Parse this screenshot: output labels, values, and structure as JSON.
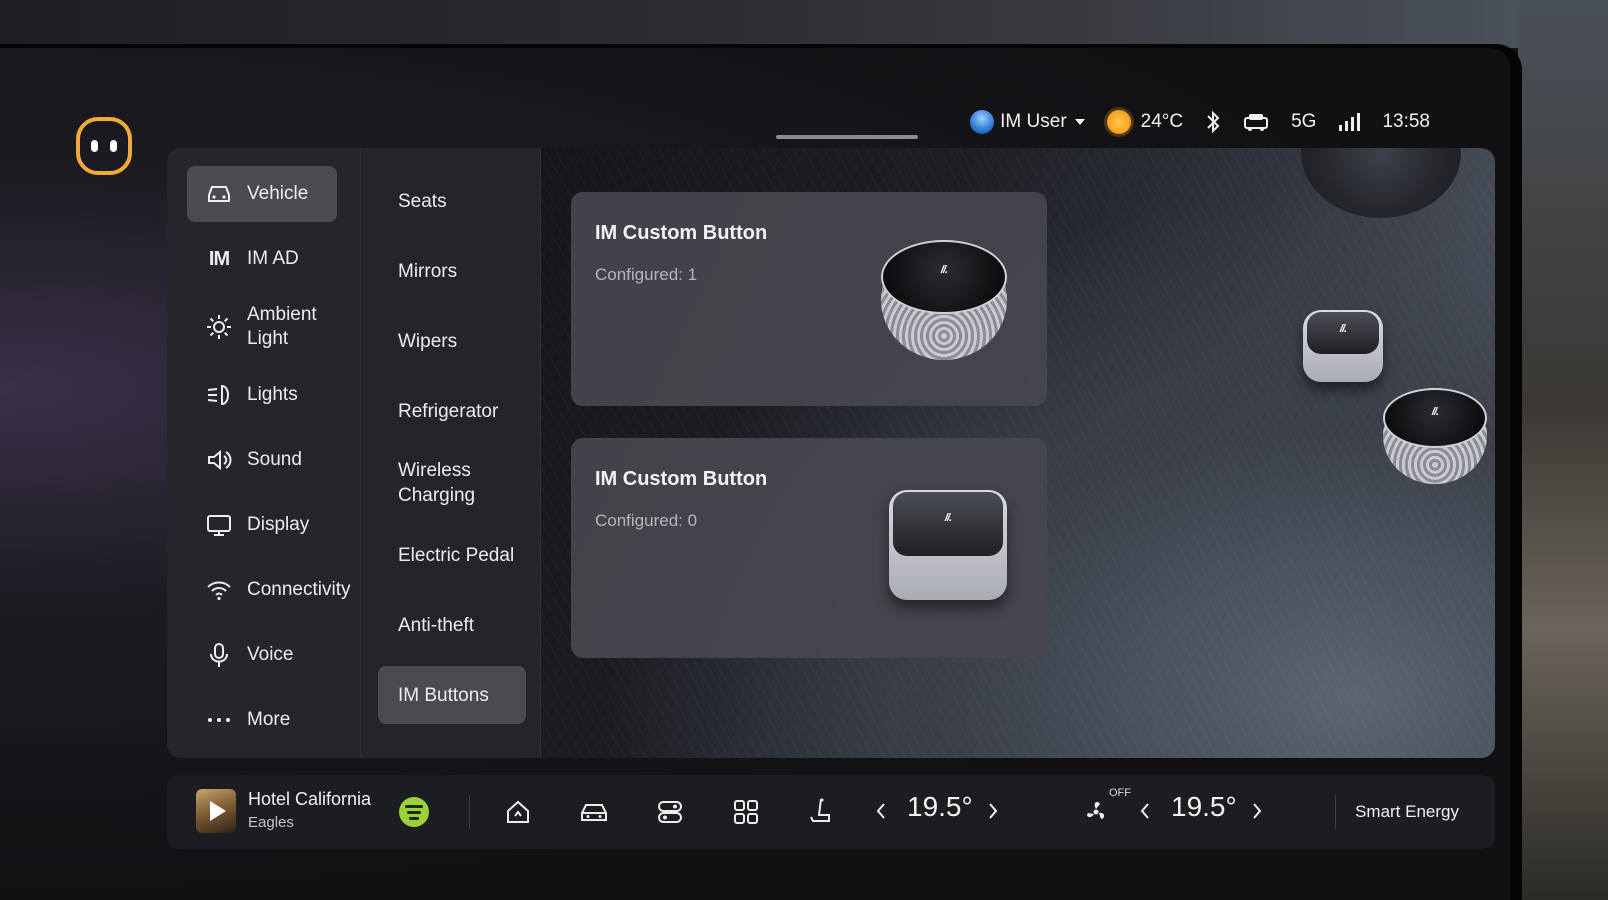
{
  "status_bar": {
    "user_name": "IM User",
    "temperature": "24°C",
    "network": "5G",
    "time": "13:58"
  },
  "nav": {
    "items": [
      {
        "label": "Vehicle",
        "icon": "car-icon",
        "active": true
      },
      {
        "label": "IM AD",
        "icon": "im-logo-icon",
        "active": false
      },
      {
        "label": "Ambient\nLight",
        "icon": "sun-icon",
        "active": false
      },
      {
        "label": "Lights",
        "icon": "headlight-icon",
        "active": false
      },
      {
        "label": "Sound",
        "icon": "speaker-icon",
        "active": false
      },
      {
        "label": "Display",
        "icon": "monitor-icon",
        "active": false
      },
      {
        "label": "Connectivity",
        "icon": "wifi-icon",
        "active": false
      },
      {
        "label": "Voice",
        "icon": "microphone-icon",
        "active": false
      },
      {
        "label": "More",
        "icon": "more-dots-icon",
        "active": false
      }
    ],
    "im_mark": "IM"
  },
  "subnav": {
    "items": [
      {
        "label": "Seats",
        "active": false
      },
      {
        "label": "Mirrors",
        "active": false
      },
      {
        "label": "Wipers",
        "active": false
      },
      {
        "label": "Refrigerator",
        "active": false
      },
      {
        "label": "Wireless\nCharging",
        "active": false
      },
      {
        "label": "Electric Pedal",
        "active": false
      },
      {
        "label": "Anti-theft",
        "active": false
      },
      {
        "label": "IM Buttons",
        "active": true
      }
    ]
  },
  "cards": [
    {
      "title": "IM Custom Button",
      "meta": "Configured: 1",
      "image": "round-knob-button"
    },
    {
      "title": "IM Custom Button",
      "meta": "Configured: 0",
      "image": "square-cube-button"
    }
  ],
  "dock": {
    "track_name": "Hotel California",
    "artist": "Eagles",
    "left_temp": "19.5°",
    "right_temp": "19.5°",
    "fan_state": "OFF",
    "smart_label": "Smart Energy"
  },
  "colors": {
    "accent": "#f2a93b",
    "active_item": "#4a4b51",
    "panel": "#25262b",
    "spotify": "#9bd13a"
  }
}
